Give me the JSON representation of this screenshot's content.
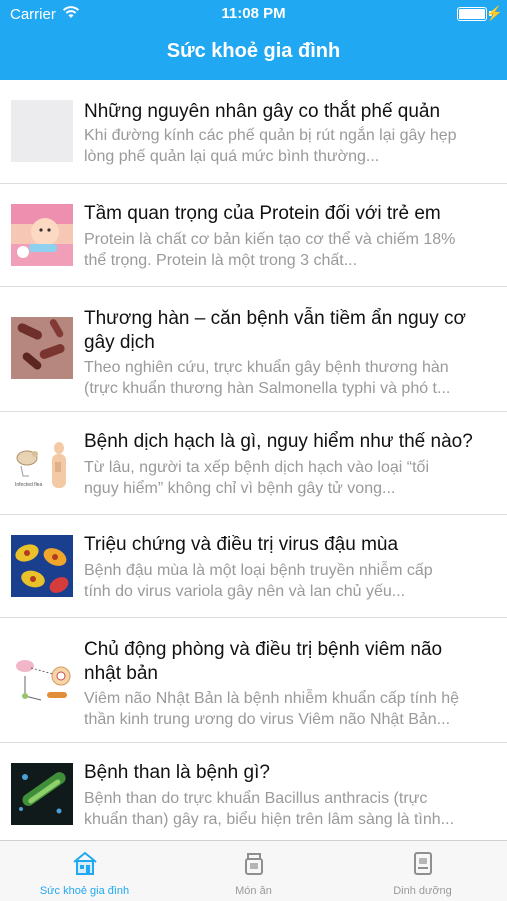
{
  "status": {
    "carrier": "Carrier",
    "time": "11:08 PM"
  },
  "header": {
    "title": "Sức khoẻ gia đình"
  },
  "articles": [
    {
      "title": "Những nguyên nhân gây co thắt phế quản",
      "desc_line1": "Khi đường kính các phế quản bị rút ngắn lại gây hẹp",
      "desc_line2": "lòng phế quản lại quá mức bình thường...",
      "thumb": "blank"
    },
    {
      "title": "Tầm quan trọng của Protein đối với trẻ em",
      "desc_line1": "Protein là chất cơ bản kiến tạo cơ thể và chiếm 18%",
      "desc_line2": "thể trọng. Protein là một trong 3 chất...",
      "thumb": "child-eating"
    },
    {
      "title_line1": "Thương hàn – căn bệnh vẫn tiềm ẩn nguy cơ",
      "title_line2": "gây dịch",
      "desc_line1": "Theo nghiên cứu, trực khuẩn gây bệnh thương hàn",
      "desc_line2": "(trực khuẩn thương hàn Salmonella typhi và phó t...",
      "thumb": "bacteria"
    },
    {
      "title": "Bệnh dịch hạch là gì, nguy hiểm như thế nào?",
      "desc_line1": "Từ lâu, người ta xếp bệnh dịch hạch vào loại “tối",
      "desc_line2": "nguy hiểm” không chỉ vì bệnh gây tử vong...",
      "thumb": "plague-diagram"
    },
    {
      "title": "Triệu chứng và điều trị virus đậu mùa",
      "desc_line1": "Bệnh đậu mùa là một loại bệnh truyền nhiễm cấp",
      "desc_line2": "tính do virus variola gây nên và lan chủ yếu...",
      "thumb": "virus"
    },
    {
      "title_line1": "Chủ động phòng và điều trị bệnh viêm não",
      "title_line2": "nhật bản",
      "desc_line1": "Viêm não Nhật Bản là bệnh nhiễm khuẩn cấp tính hệ",
      "desc_line2": "thần kinh trung ương do virus Viêm não Nhật Bản...",
      "thumb": "encephalitis-diagram"
    },
    {
      "title": "Bệnh than là bệnh gì?",
      "desc_line1": "Bệnh than do trực khuẩn Bacillus anthracis (trực",
      "desc_line2": "khuẩn than) gây ra, biểu hiện trên lâm sàng là tình...",
      "thumb": "anthrax"
    }
  ],
  "tabs": [
    {
      "label": "Sức khoẻ gia đình",
      "icon": "home-icon",
      "active": true
    },
    {
      "label": "Món ăn",
      "icon": "food-icon",
      "active": false
    },
    {
      "label": "Dinh dưỡng",
      "icon": "nutrition-icon",
      "active": false
    }
  ],
  "colors": {
    "accent": "#21a8f2",
    "separator": "#dedede",
    "muted_text": "#9a9a9a"
  }
}
